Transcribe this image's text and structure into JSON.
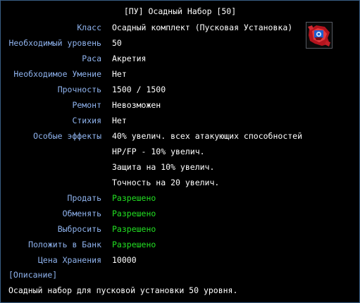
{
  "title": "[ПУ] Осадный Набор [50]",
  "item_icon": "siege-kit-icon",
  "colors": {
    "label": "#8fb3ee",
    "value": "#ffffff",
    "allowed": "#22e022",
    "border": "#3a5f86"
  },
  "properties": [
    {
      "label": "Класс",
      "value": "Осадный комплект (Пусковая Установка)"
    },
    {
      "label": "Необходимый уровень",
      "value": "50"
    },
    {
      "label": "Раса",
      "value": "Акретия"
    },
    {
      "label": "Необходимое Умение",
      "value": "Нет"
    },
    {
      "label": "Прочность",
      "value": "1500 / 1500"
    },
    {
      "label": "Ремонт",
      "value": "Невозможен"
    },
    {
      "label": "Стихия",
      "value": "Нет"
    },
    {
      "label": "Особые эффекты",
      "value": "40% увелич. всех атакующих способностей"
    }
  ],
  "extra_effects": [
    "HP/FP - 10% увелич.",
    "Защита на 10% увелич.",
    "Точность на 20 увелич."
  ],
  "permissions": [
    {
      "label": "Продать",
      "value": "Разрешено"
    },
    {
      "label": "Обменять",
      "value": "Разрешено"
    },
    {
      "label": "Выбросить",
      "value": "Разрешено"
    },
    {
      "label": "Положить в Банк",
      "value": "Разрешено"
    }
  ],
  "storage": {
    "label": "Цена Хранения",
    "value": "10000"
  },
  "description_header": "[Описание]",
  "description": "Осадный набор для пусковой установки 50 уровня."
}
